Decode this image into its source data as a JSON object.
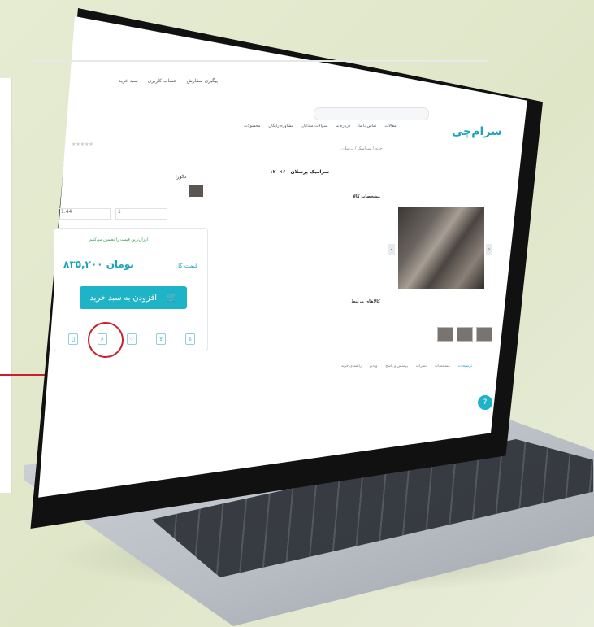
{
  "header": {
    "logo": "سرام‌چی",
    "links": [
      "سبد خرید",
      "حساب کاربری",
      "پیگیری سفارش"
    ],
    "nav": [
      "محصولات",
      "مشاوره رایگان",
      "سوالات متداول",
      "درباره ما",
      "تماس با ما",
      "مقالات"
    ]
  },
  "product": {
    "title": "سرامیک پرسلان ۶۰×۱۲۰",
    "breadcrumb": "خانه / سرامیک / پرسلان",
    "info_title": "مشخصات کالا",
    "related_title": "کالاهای مرتبط"
  },
  "purchase": {
    "variant_name": "دکورا",
    "qty_value": "1",
    "area_value": "1.44",
    "cheapest_note": "ارزان‌ترین قیمت را تضمین می‌کنیم",
    "price_label": "قیمت کل",
    "price": "۸۳۵,۲۰۰ تومان",
    "add_to_cart": "افزودن به سبد خرید"
  },
  "tabs": [
    "توضیحات",
    "مشخصات",
    "نظرات",
    "پرسش و پاسخ",
    "ویدیو",
    "راهنمای خرید"
  ],
  "colors": {
    "accent": "#1fb3c7",
    "highlight": "#c8202d"
  },
  "icons": [
    "compare-icon",
    "zoom-icon",
    "favorite-icon",
    "share-icon",
    "download-icon"
  ]
}
